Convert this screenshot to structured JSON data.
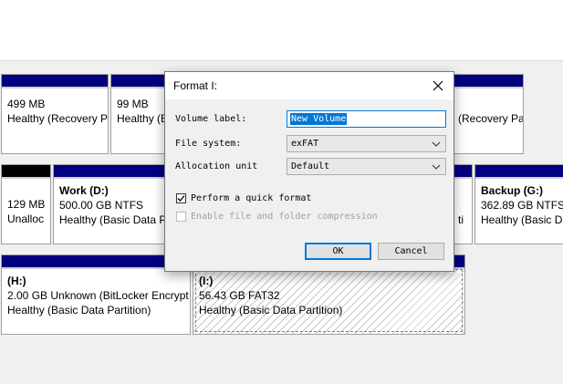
{
  "disk1": {
    "p1": {
      "size": "499 MB",
      "status": "Healthy (Recovery P"
    },
    "p2": {
      "size": "99 MB",
      "status": "Healthy (E"
    },
    "p3": {
      "status": "(Recovery Pa"
    }
  },
  "disk2": {
    "unalloc": {
      "size": "129 MB",
      "status": "Unalloc"
    },
    "work": {
      "title": "Work  (D:)",
      "size": "500.00 GB NTFS",
      "status": "Healthy (Basic Data Pa"
    },
    "mid": {
      "status": "ti"
    },
    "backup": {
      "title": "Backup  (G:)",
      "size": "362.89 GB NTFS",
      "status": "Healthy (Basic Da"
    }
  },
  "disk3": {
    "h": {
      "title": "(H:)",
      "size": "2.00 GB Unknown (BitLocker Encrypt",
      "status": "Healthy (Basic Data Partition)"
    },
    "i": {
      "title": "(I:)",
      "size": "56.43 GB FAT32",
      "status": "Healthy (Basic Data Partition)"
    }
  },
  "dialog": {
    "title": "Format I:",
    "volume_label": {
      "label": "Volume label:",
      "value": "New Volume"
    },
    "file_system": {
      "label": "File system:",
      "value": "exFAT"
    },
    "allocation_unit": {
      "label": "Allocation unit",
      "value": "Default"
    },
    "quick_format": {
      "label": "Perform a quick format",
      "checked": true
    },
    "compression": {
      "label": "Enable file and folder compression",
      "checked": false,
      "disabled": true
    },
    "ok_label": "OK",
    "cancel_label": "Cancel"
  }
}
